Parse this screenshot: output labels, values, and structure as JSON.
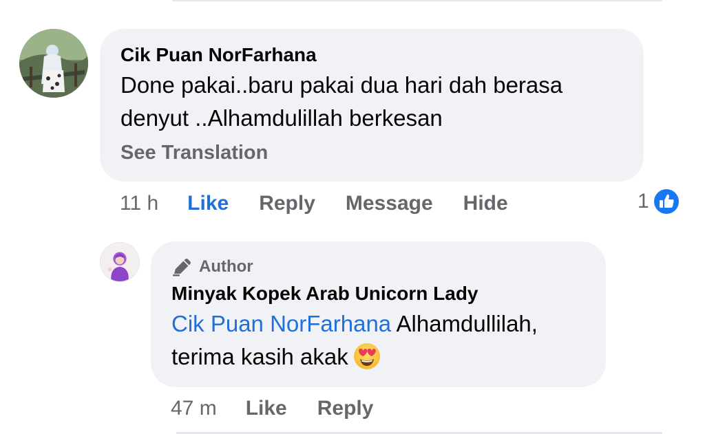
{
  "comment": {
    "author": "Cik Puan NorFarhana",
    "text_line1": "Done pakai..baru pakai dua hari dah berasa",
    "text_line2": "denyut ..Alhamdulillah berkesan",
    "see_translation": "See Translation",
    "time": "11 h",
    "actions": {
      "like": "Like",
      "reply": "Reply",
      "message": "Message",
      "hide": "Hide"
    },
    "reaction_count": "1",
    "reaction_icon": "like-thumb-icon",
    "avatar_icon": "profile-photo"
  },
  "reply": {
    "badge_icon": "pen-icon",
    "badge_label": "Author",
    "author": "Minyak Kopek Arab Unicorn Lady",
    "mention": "Cik Puan NorFarhana",
    "text_after_mention": " Alhamdullilah,",
    "text_line2": "terima kasih akak",
    "emoji": "heart-eyes-emoji",
    "time": "47 m",
    "actions": {
      "like": "Like",
      "reply": "Reply"
    },
    "avatar_icon": "profile-photo"
  },
  "colors": {
    "bubble_bg": "#f0f2f5",
    "link_blue": "#216fdb",
    "secondary_text": "#65676b",
    "primary_text": "#050505"
  }
}
